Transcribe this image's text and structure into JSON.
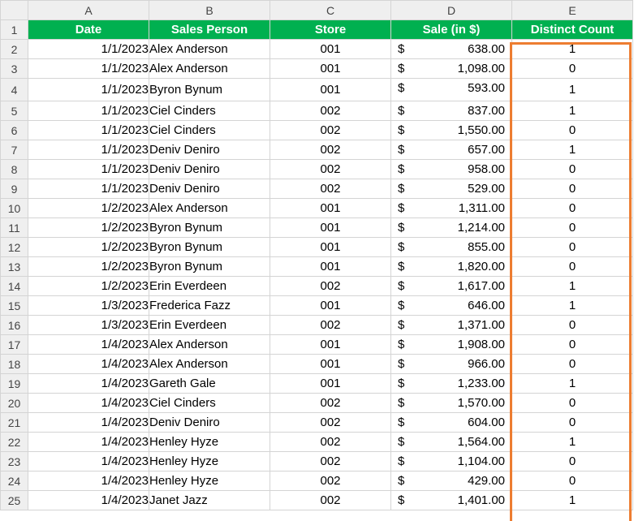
{
  "columns": [
    "A",
    "B",
    "C",
    "D",
    "E"
  ],
  "header_row_number": "1",
  "headers": {
    "date": "Date",
    "sales_person": "Sales Person",
    "store": "Store",
    "sale": "Sale (in $)",
    "distinct_count": "Distinct Count"
  },
  "colors": {
    "header_fill": "#00b050",
    "header_text": "#ffffff",
    "highlight_border": "#ed7d31"
  },
  "rows": [
    {
      "row": "2",
      "date": "1/1/2023",
      "person": "Alex Anderson",
      "store": "001",
      "currency": "$",
      "sale": "638.00",
      "count": "1"
    },
    {
      "row": "3",
      "date": "1/1/2023",
      "person": "Alex Anderson",
      "store": "001",
      "currency": "$",
      "sale": "1,098.00",
      "count": "0"
    },
    {
      "row": "4",
      "date": "1/1/2023",
      "person": "Byron Bynum",
      "store": "001",
      "currency": "$",
      "sale": "593.00",
      "count": "1"
    },
    {
      "row": "5",
      "date": "1/1/2023",
      "person": "Ciel Cinders",
      "store": "002",
      "currency": "$",
      "sale": "837.00",
      "count": "1"
    },
    {
      "row": "6",
      "date": "1/1/2023",
      "person": "Ciel Cinders",
      "store": "002",
      "currency": "$",
      "sale": "1,550.00",
      "count": "0"
    },
    {
      "row": "7",
      "date": "1/1/2023",
      "person": "Deniv Deniro",
      "store": "002",
      "currency": "$",
      "sale": "657.00",
      "count": "1"
    },
    {
      "row": "8",
      "date": "1/1/2023",
      "person": "Deniv Deniro",
      "store": "002",
      "currency": "$",
      "sale": "958.00",
      "count": "0"
    },
    {
      "row": "9",
      "date": "1/1/2023",
      "person": "Deniv Deniro",
      "store": "002",
      "currency": "$",
      "sale": "529.00",
      "count": "0"
    },
    {
      "row": "10",
      "date": "1/2/2023",
      "person": "Alex Anderson",
      "store": "001",
      "currency": "$",
      "sale": "1,311.00",
      "count": "0"
    },
    {
      "row": "11",
      "date": "1/2/2023",
      "person": "Byron Bynum",
      "store": "001",
      "currency": "$",
      "sale": "1,214.00",
      "count": "0"
    },
    {
      "row": "12",
      "date": "1/2/2023",
      "person": "Byron Bynum",
      "store": "001",
      "currency": "$",
      "sale": "855.00",
      "count": "0"
    },
    {
      "row": "13",
      "date": "1/2/2023",
      "person": "Byron Bynum",
      "store": "001",
      "currency": "$",
      "sale": "1,820.00",
      "count": "0"
    },
    {
      "row": "14",
      "date": "1/2/2023",
      "person": "Erin Everdeen",
      "store": "002",
      "currency": "$",
      "sale": "1,617.00",
      "count": "1"
    },
    {
      "row": "15",
      "date": "1/3/2023",
      "person": "Frederica Fazz",
      "store": "001",
      "currency": "$",
      "sale": "646.00",
      "count": "1"
    },
    {
      "row": "16",
      "date": "1/3/2023",
      "person": "Erin Everdeen",
      "store": "002",
      "currency": "$",
      "sale": "1,371.00",
      "count": "0"
    },
    {
      "row": "17",
      "date": "1/4/2023",
      "person": "Alex Anderson",
      "store": "001",
      "currency": "$",
      "sale": "1,908.00",
      "count": "0"
    },
    {
      "row": "18",
      "date": "1/4/2023",
      "person": "Alex Anderson",
      "store": "001",
      "currency": "$",
      "sale": "966.00",
      "count": "0"
    },
    {
      "row": "19",
      "date": "1/4/2023",
      "person": "Gareth Gale",
      "store": "001",
      "currency": "$",
      "sale": "1,233.00",
      "count": "1"
    },
    {
      "row": "20",
      "date": "1/4/2023",
      "person": "Ciel Cinders",
      "store": "002",
      "currency": "$",
      "sale": "1,570.00",
      "count": "0"
    },
    {
      "row": "21",
      "date": "1/4/2023",
      "person": "Deniv Deniro",
      "store": "002",
      "currency": "$",
      "sale": "604.00",
      "count": "0"
    },
    {
      "row": "22",
      "date": "1/4/2023",
      "person": "Henley Hyze",
      "store": "002",
      "currency": "$",
      "sale": "1,564.00",
      "count": "1"
    },
    {
      "row": "23",
      "date": "1/4/2023",
      "person": "Henley Hyze",
      "store": "002",
      "currency": "$",
      "sale": "1,104.00",
      "count": "0"
    },
    {
      "row": "24",
      "date": "1/4/2023",
      "person": "Henley Hyze",
      "store": "002",
      "currency": "$",
      "sale": "429.00",
      "count": "0"
    },
    {
      "row": "25",
      "date": "1/4/2023",
      "person": "Janet Jazz",
      "store": "002",
      "currency": "$",
      "sale": "1,401.00",
      "count": "1"
    }
  ]
}
